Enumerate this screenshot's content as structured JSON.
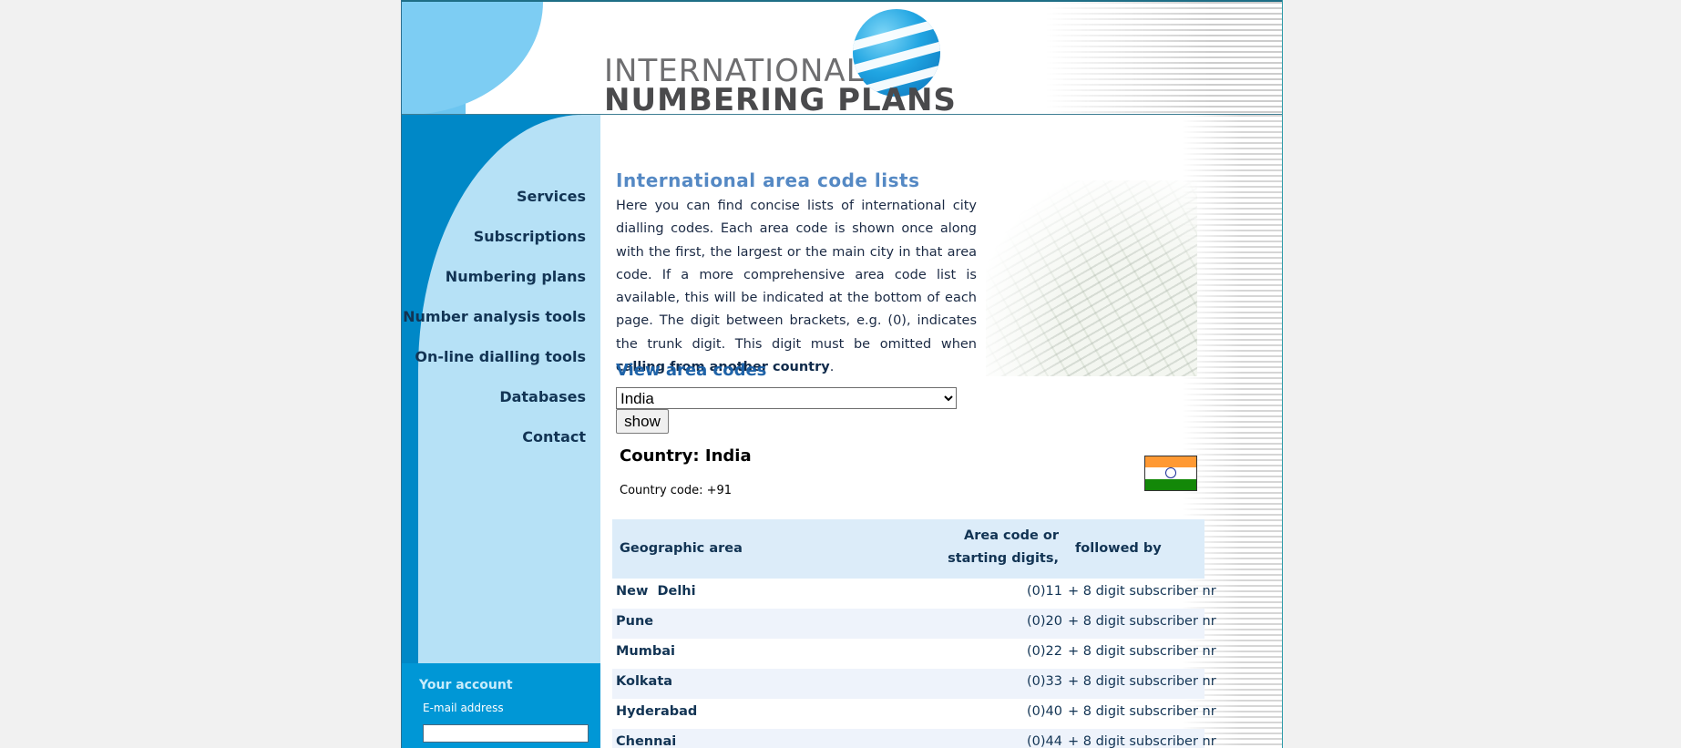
{
  "logo": {
    "line1": "INTERNATIONAL",
    "line2": "NUMBERING PLANS"
  },
  "nav": {
    "items": [
      {
        "label": "Services"
      },
      {
        "label": "Subscriptions"
      },
      {
        "label": "Numbering plans"
      },
      {
        "label": "Number analysis tools"
      },
      {
        "label": "On-line dialling tools"
      },
      {
        "label": "Databases"
      },
      {
        "label": "Contact"
      }
    ]
  },
  "account": {
    "title": "Your account",
    "email_label": "E-mail address",
    "email_value": ""
  },
  "main": {
    "title": "International area code lists",
    "intro": "Here you can find concise lists of international city dialling codes. Each area code is shown once along with the first, the largest or the main city in that area code. If a more comprehensive area code list is available, this will be indicated at the bottom of each page. The digit between brackets, e.g. (0), indicates the trunk digit. This digit must be omitted when ",
    "intro_link": "calling from another country",
    "intro_end": ".",
    "view_title": "View area codes",
    "select_value": "India",
    "show_label": "show",
    "country_heading": "Country: India",
    "country_code": "Country code: +91"
  },
  "table": {
    "headers": {
      "area": "Geographic area",
      "code_line1": "Area code or",
      "code_line2": "starting digits,",
      "follow": "followed by"
    },
    "rows": [
      {
        "city": "New  Delhi",
        "code": "(0)11",
        "follow": "+ 8 digit subscriber nr"
      },
      {
        "city": "Pune",
        "code": "(0)20",
        "follow": "+ 8 digit subscriber nr"
      },
      {
        "city": "Mumbai",
        "code": "(0)22",
        "follow": "+ 8 digit subscriber nr"
      },
      {
        "city": "Kolkata",
        "code": "(0)33",
        "follow": "+ 8 digit subscriber nr"
      },
      {
        "city": "Hyderabad",
        "code": "(0)40",
        "follow": "+ 8 digit subscriber nr"
      },
      {
        "city": "Chennai",
        "code": "(0)44",
        "follow": "+ 8 digit subscriber nr"
      }
    ]
  },
  "colors": {
    "sidebar_dark": "#0088c7",
    "sidebar_light": "#b6e1f6",
    "title_blue": "#5589c4",
    "heading_blue": "#1f63a8",
    "table_header_bg": "#dcecf9",
    "flag_saffron": "#ff9933",
    "flag_green": "#138808"
  },
  "icons": {
    "flag": "india-flag-icon",
    "logo": "globe-logo-icon",
    "photo": "phone-directory-photo"
  }
}
